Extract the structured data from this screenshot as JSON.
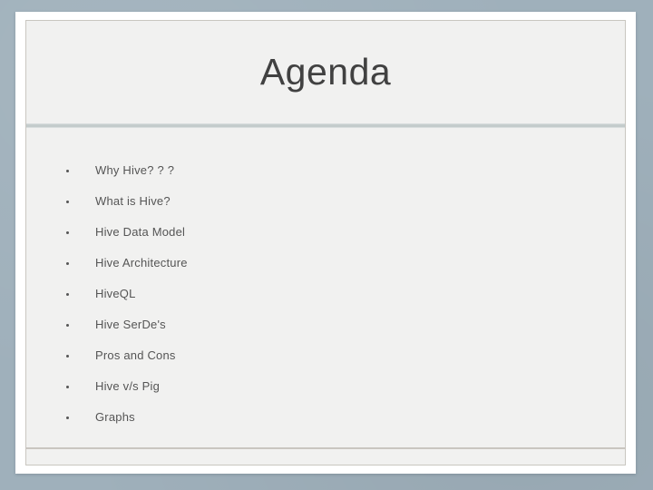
{
  "slide": {
    "title": "Agenda",
    "bullets": [
      {
        "text": "Why Hive? ? ?"
      },
      {
        "text": "What is Hive?"
      },
      {
        "text": "Hive Data Model"
      },
      {
        "text": "Hive Architecture"
      },
      {
        "text": "HiveQL"
      },
      {
        "text": "Hive SerDe's"
      },
      {
        "text": "Pros and Cons"
      },
      {
        "text": "Hive v/s Pig"
      },
      {
        "text": "Graphs"
      }
    ]
  },
  "theme": {
    "matte_color": "#9fb0bb",
    "frame_color": "#ffffff",
    "canvas_color": "#f1f1f0",
    "canvas_border_color": "#c9c6c0",
    "title_color": "#414141",
    "body_text_color": "#555555",
    "title_divider_color": "#c3cbcb",
    "footer_divider_color": "#c9c6c0"
  }
}
